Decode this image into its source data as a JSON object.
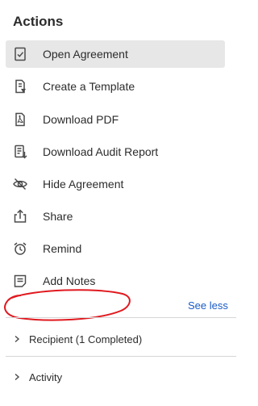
{
  "panel": {
    "title": "Actions"
  },
  "actions": [
    {
      "label": "Open Agreement",
      "icon": "open-agreement-icon",
      "selected": true
    },
    {
      "label": "Create a Template",
      "icon": "template-icon",
      "selected": false
    },
    {
      "label": "Download PDF",
      "icon": "pdf-icon",
      "selected": false
    },
    {
      "label": "Download Audit Report",
      "icon": "audit-report-icon",
      "selected": false
    },
    {
      "label": "Hide Agreement",
      "icon": "eye-slash-icon",
      "selected": false
    },
    {
      "label": "Share",
      "icon": "share-icon",
      "selected": false
    },
    {
      "label": "Remind",
      "icon": "alarm-clock-icon",
      "selected": false
    },
    {
      "label": "Add Notes",
      "icon": "notes-icon",
      "selected": false
    }
  ],
  "see_less": "See less",
  "sections": [
    {
      "label": "Recipient (1 Completed)",
      "icon": "chevron-right-icon"
    },
    {
      "label": "Activity",
      "icon": "chevron-right-icon"
    }
  ],
  "colors": {
    "link": "#1a5bc6",
    "selected_bg": "#e7e7e7",
    "annotation": "#e0191f"
  }
}
